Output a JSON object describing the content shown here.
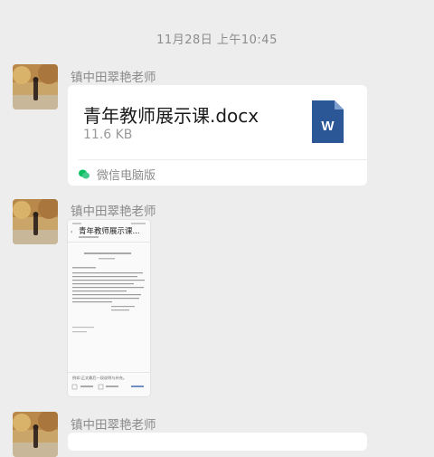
{
  "chat": {
    "timestamp": "11月28日 上午10:45",
    "messages": [
      {
        "sender": "镇中田翠艳老师",
        "type": "file",
        "file_name": "青年教师展示课.docx",
        "file_size": "11.6 KB",
        "file_icon": "word-doc-icon",
        "file_icon_letter": "W",
        "source": "微信电脑版",
        "source_icon": "wechat-icon"
      },
      {
        "sender": "镇中田翠艳老师",
        "type": "image",
        "thumb_title": "青年教师展示课...",
        "thumb_body": "例如:正文最后一段说明与补充。"
      },
      {
        "sender": "镇中田翠艳老师",
        "type": "text"
      }
    ]
  },
  "colors": {
    "background": "#ededed",
    "bubble": "#ffffff",
    "word_blue": "#2b5797",
    "wechat_green": "#07c160"
  }
}
